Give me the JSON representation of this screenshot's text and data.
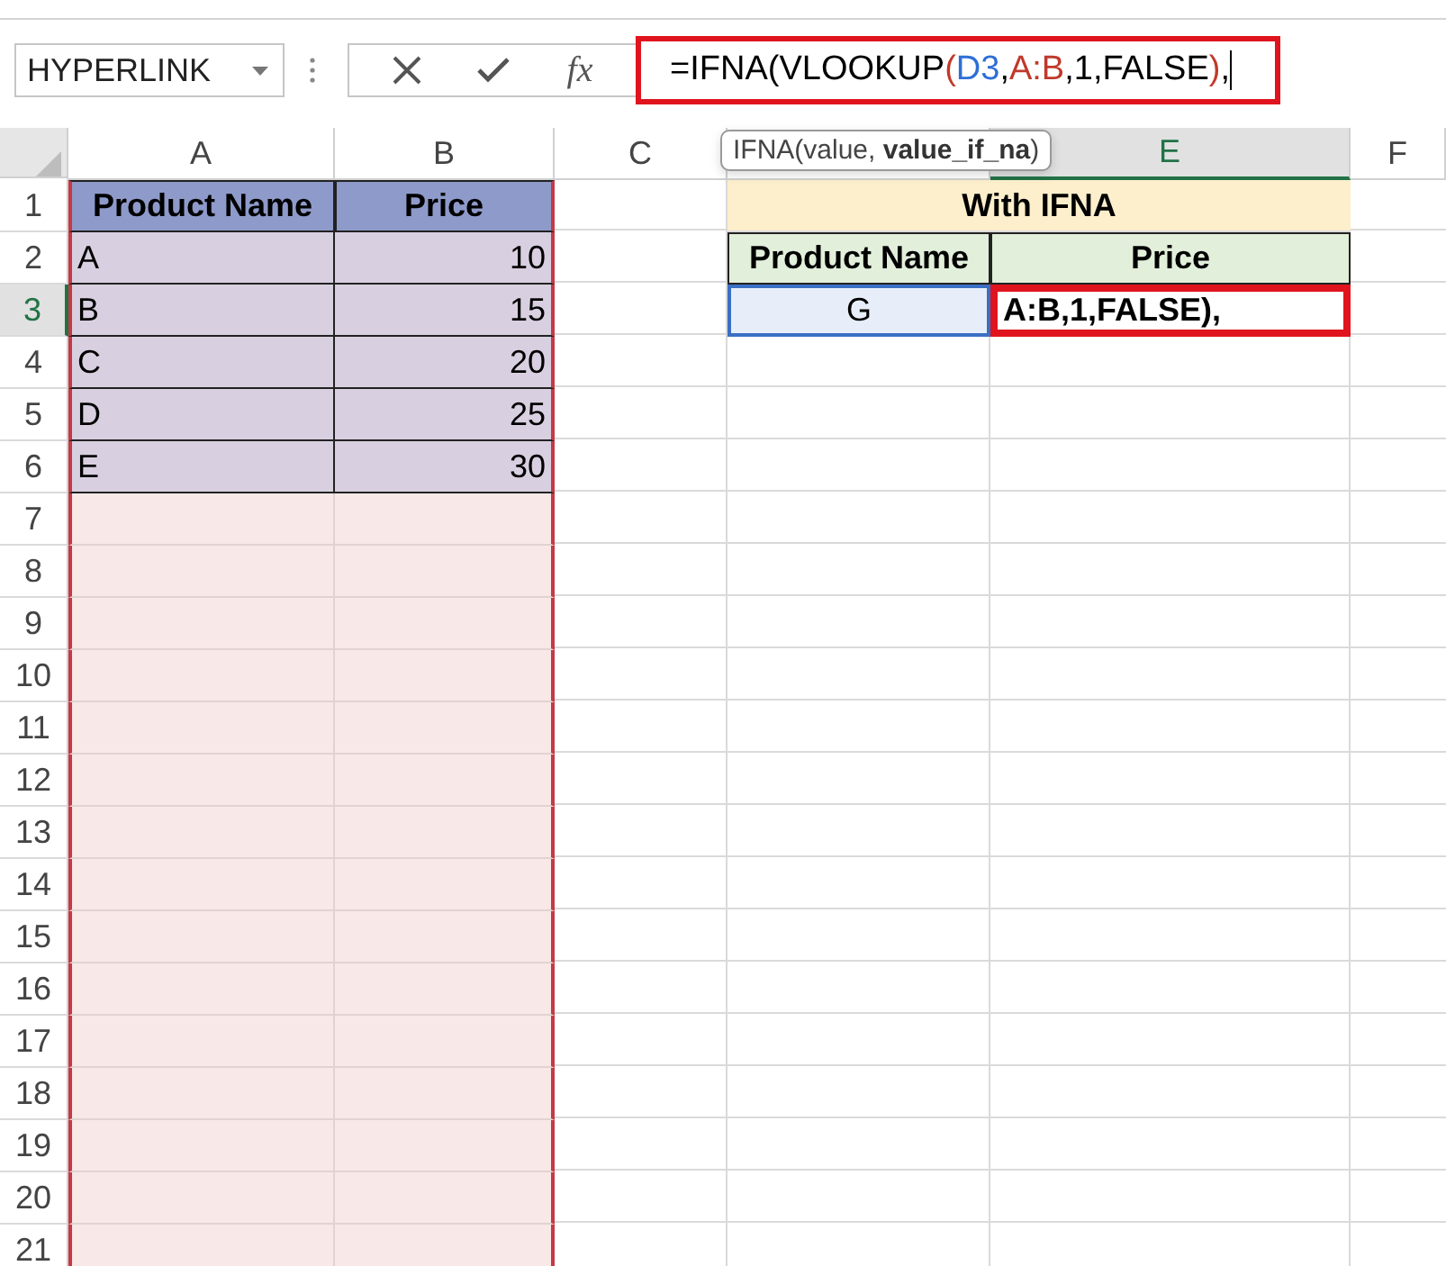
{
  "formula_bar": {
    "name_box": "HYPERLINK",
    "function_label": "fx",
    "formula": [
      {
        "text": "=IFNA(VLOOKUP",
        "color": "#000000"
      },
      {
        "text": "(",
        "color": "#c0392b"
      },
      {
        "text": "D3",
        "color": "#2e6fd6"
      },
      {
        "text": ",",
        "color": "#000000"
      },
      {
        "text": "A:B",
        "color": "#c0392b"
      },
      {
        "text": ",1,FALSE",
        "color": "#000000"
      },
      {
        "text": ")",
        "color": "#c0392b"
      },
      {
        "text": ",",
        "color": "#000000"
      }
    ]
  },
  "tooltip": "IFNA(value, **value_if_na**)",
  "columns": [
    {
      "label": "A",
      "selected": false,
      "referenced": true
    },
    {
      "label": "B",
      "selected": false,
      "referenced": true
    },
    {
      "label": "C",
      "selected": false,
      "referenced": false
    },
    {
      "selected": false,
      "referenced": false
    },
    {
      "label": "E",
      "selected": true,
      "referenced": false
    },
    {
      "label": "F",
      "selected": false,
      "referenced": false
    }
  ],
  "rows": [
    {
      "number": "1",
      "selected": false,
      "cells": [
        {
          "kind": "header",
          "text": "Product Name"
        },
        {
          "kind": "header",
          "text": "Price"
        },
        {
          "kind": "blank"
        },
        {
          "kind": "title",
          "text": "With IFNA"
        },
        {
          "kind": "blank"
        }
      ]
    },
    {
      "number": "2",
      "selected": false,
      "cells": [
        {
          "kind": "text",
          "text": "A"
        },
        {
          "kind": "number",
          "text": "10"
        },
        {
          "kind": "blank"
        },
        {
          "kind": "label",
          "text": "Product Name"
        },
        {
          "kind": "label",
          "text": "Price"
        },
        {
          "kind": "blank"
        }
      ]
    },
    {
      "number": "3",
      "selected": true,
      "cells": [
        {
          "kind": "text",
          "text": "B"
        },
        {
          "kind": "number",
          "text": "15"
        },
        {
          "kind": "blank"
        },
        {
          "kind": "active",
          "text": "G"
        },
        {
          "kind": "editing",
          "text": "A:B,1,FALSE),"
        },
        {
          "kind": "blank"
        }
      ]
    },
    {
      "number": "4",
      "selected": false,
      "cells": [
        {
          "kind": "text",
          "text": "C"
        },
        {
          "kind": "number",
          "text": "20"
        },
        {
          "kind": "blank"
        },
        {
          "kind": "blank"
        },
        {
          "kind": "blank"
        },
        {
          "kind": "blank"
        }
      ]
    },
    {
      "number": "5",
      "selected": false,
      "cells": [
        {
          "kind": "text",
          "text": "D"
        },
        {
          "kind": "number",
          "text": "25"
        },
        {
          "kind": "blank"
        },
        {
          "kind": "blank"
        },
        {
          "kind": "blank"
        },
        {
          "kind": "blank"
        }
      ]
    },
    {
      "number": "6",
      "selected": false,
      "cells": [
        {
          "kind": "text",
          "text": "E"
        },
        {
          "kind": "number",
          "text": "30"
        },
        {
          "kind": "blank"
        },
        {
          "kind": "blank"
        },
        {
          "kind": "blank"
        },
        {
          "kind": "blank"
        }
      ]
    },
    {
      "number": "7",
      "selected": false,
      "cells": [
        {
          "kind": "shaded"
        },
        {
          "kind": "shaded"
        },
        {
          "kind": "blank"
        },
        {
          "kind": "blank"
        },
        {
          "kind": "blank"
        },
        {
          "kind": "blank"
        }
      ]
    },
    {
      "number": "8",
      "selected": false,
      "cells": [
        {
          "kind": "shaded"
        },
        {
          "kind": "shaded"
        },
        {
          "kind": "blank"
        },
        {
          "kind": "blank"
        },
        {
          "kind": "blank"
        },
        {
          "kind": "blank"
        }
      ]
    },
    {
      "number": "9",
      "selected": false,
      "cells": [
        {
          "kind": "shaded"
        },
        {
          "kind": "shaded"
        },
        {
          "kind": "blank"
        },
        {
          "kind": "blank"
        },
        {
          "kind": "blank"
        },
        {
          "kind": "blank"
        }
      ]
    },
    {
      "number": "10",
      "selected": false,
      "cells": [
        {
          "kind": "shaded"
        },
        {
          "kind": "shaded"
        },
        {
          "kind": "blank"
        },
        {
          "kind": "blank"
        },
        {
          "kind": "blank"
        },
        {
          "kind": "blank"
        }
      ]
    },
    {
      "number": "11",
      "selected": false,
      "cells": [
        {
          "kind": "shaded"
        },
        {
          "kind": "shaded"
        },
        {
          "kind": "blank"
        },
        {
          "kind": "blank"
        },
        {
          "kind": "blank"
        },
        {
          "kind": "blank"
        }
      ]
    },
    {
      "number": "12",
      "selected": false,
      "cells": [
        {
          "kind": "shaded"
        },
        {
          "kind": "shaded"
        },
        {
          "kind": "blank"
        },
        {
          "kind": "blank"
        },
        {
          "kind": "blank"
        },
        {
          "kind": "blank"
        }
      ]
    },
    {
      "number": "13",
      "selected": false,
      "cells": [
        {
          "kind": "shaded"
        },
        {
          "kind": "shaded"
        },
        {
          "kind": "blank"
        },
        {
          "kind": "blank"
        },
        {
          "kind": "blank"
        },
        {
          "kind": "blank"
        }
      ]
    },
    {
      "number": "14",
      "selected": false,
      "cells": [
        {
          "kind": "shaded"
        },
        {
          "kind": "shaded"
        },
        {
          "kind": "blank"
        },
        {
          "kind": "blank"
        },
        {
          "kind": "blank"
        },
        {
          "kind": "blank"
        }
      ]
    },
    {
      "number": "15",
      "selected": false,
      "cells": [
        {
          "kind": "shaded"
        },
        {
          "kind": "shaded"
        },
        {
          "kind": "blank"
        },
        {
          "kind": "blank"
        },
        {
          "kind": "blank"
        },
        {
          "kind": "blank"
        }
      ]
    },
    {
      "number": "16",
      "selected": false,
      "cells": [
        {
          "kind": "shaded"
        },
        {
          "kind": "shaded"
        },
        {
          "kind": "blank"
        },
        {
          "kind": "blank"
        },
        {
          "kind": "blank"
        },
        {
          "kind": "blank"
        }
      ]
    },
    {
      "number": "17",
      "selected": false,
      "cells": [
        {
          "kind": "shaded"
        },
        {
          "kind": "shaded"
        },
        {
          "kind": "blank"
        },
        {
          "kind": "blank"
        },
        {
          "kind": "blank"
        },
        {
          "kind": "blank"
        }
      ]
    },
    {
      "number": "18",
      "selected": false,
      "cells": [
        {
          "kind": "shaded"
        },
        {
          "kind": "shaded"
        },
        {
          "kind": "blank"
        },
        {
          "kind": "blank"
        },
        {
          "kind": "blank"
        },
        {
          "kind": "blank"
        }
      ]
    },
    {
      "number": "19",
      "selected": false,
      "cells": [
        {
          "kind": "shaded"
        },
        {
          "kind": "shaded"
        },
        {
          "kind": "blank"
        },
        {
          "kind": "blank"
        },
        {
          "kind": "blank"
        },
        {
          "kind": "blank"
        }
      ]
    },
    {
      "number": "20",
      "selected": false,
      "cells": [
        {
          "kind": "shaded"
        },
        {
          "kind": "shaded"
        },
        {
          "kind": "blank"
        },
        {
          "kind": "blank"
        },
        {
          "kind": "blank"
        },
        {
          "kind": "blank"
        }
      ]
    },
    {
      "number": "21",
      "selected": false,
      "cells": [
        {
          "kind": "shaded"
        },
        {
          "kind": "shaded"
        },
        {
          "kind": "blank"
        },
        {
          "kind": "blank"
        },
        {
          "kind": "blank"
        },
        {
          "kind": "blank"
        }
      ]
    }
  ]
}
